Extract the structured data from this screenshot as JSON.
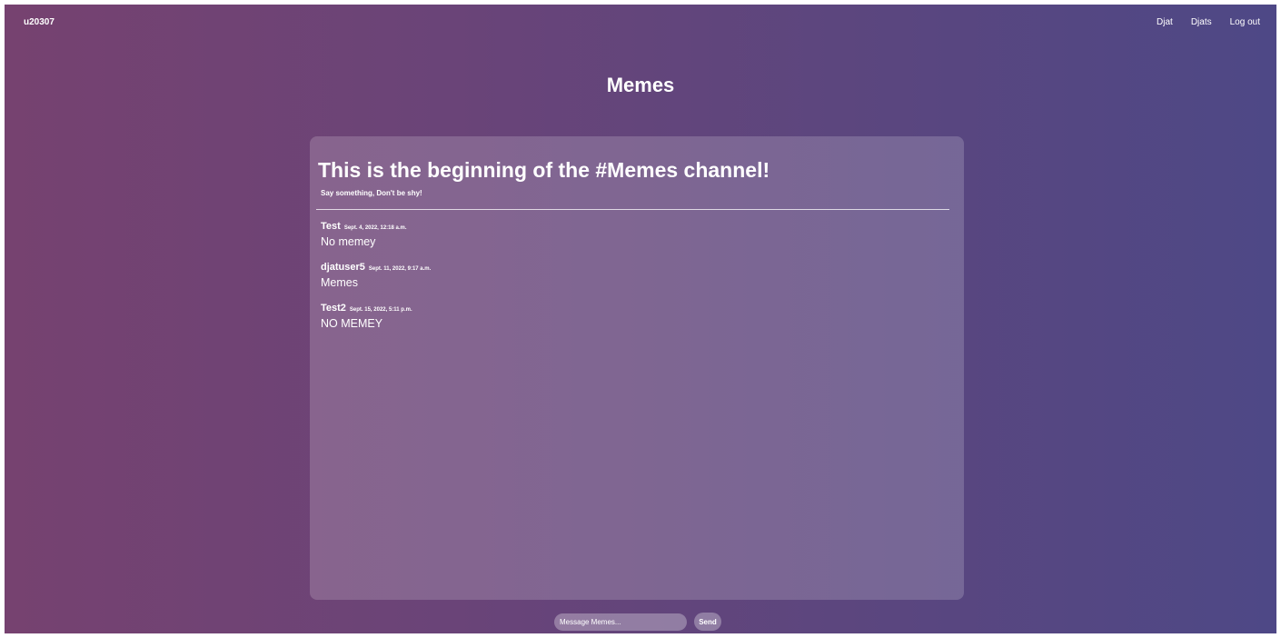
{
  "header": {
    "username": "u20307",
    "nav": [
      {
        "label": "Djat"
      },
      {
        "label": "Djats"
      },
      {
        "label": "Log out"
      }
    ]
  },
  "page_title": "Memes",
  "channel": {
    "heading": "This is the beginning of the #Memes channel!",
    "subtitle": "Say something, Don't be shy!"
  },
  "messages": [
    {
      "user": "Test",
      "time": "Sept. 4, 2022, 12:18 a.m.",
      "text": "No memey"
    },
    {
      "user": "djatuser5",
      "time": "Sept. 11, 2022, 9:17 a.m.",
      "text": "Memes"
    },
    {
      "user": "Test2",
      "time": "Sept. 15, 2022, 5:11 p.m.",
      "text": "NO MEMEY"
    }
  ],
  "composer": {
    "placeholder": "Message Memes...",
    "send_label": "Send"
  }
}
